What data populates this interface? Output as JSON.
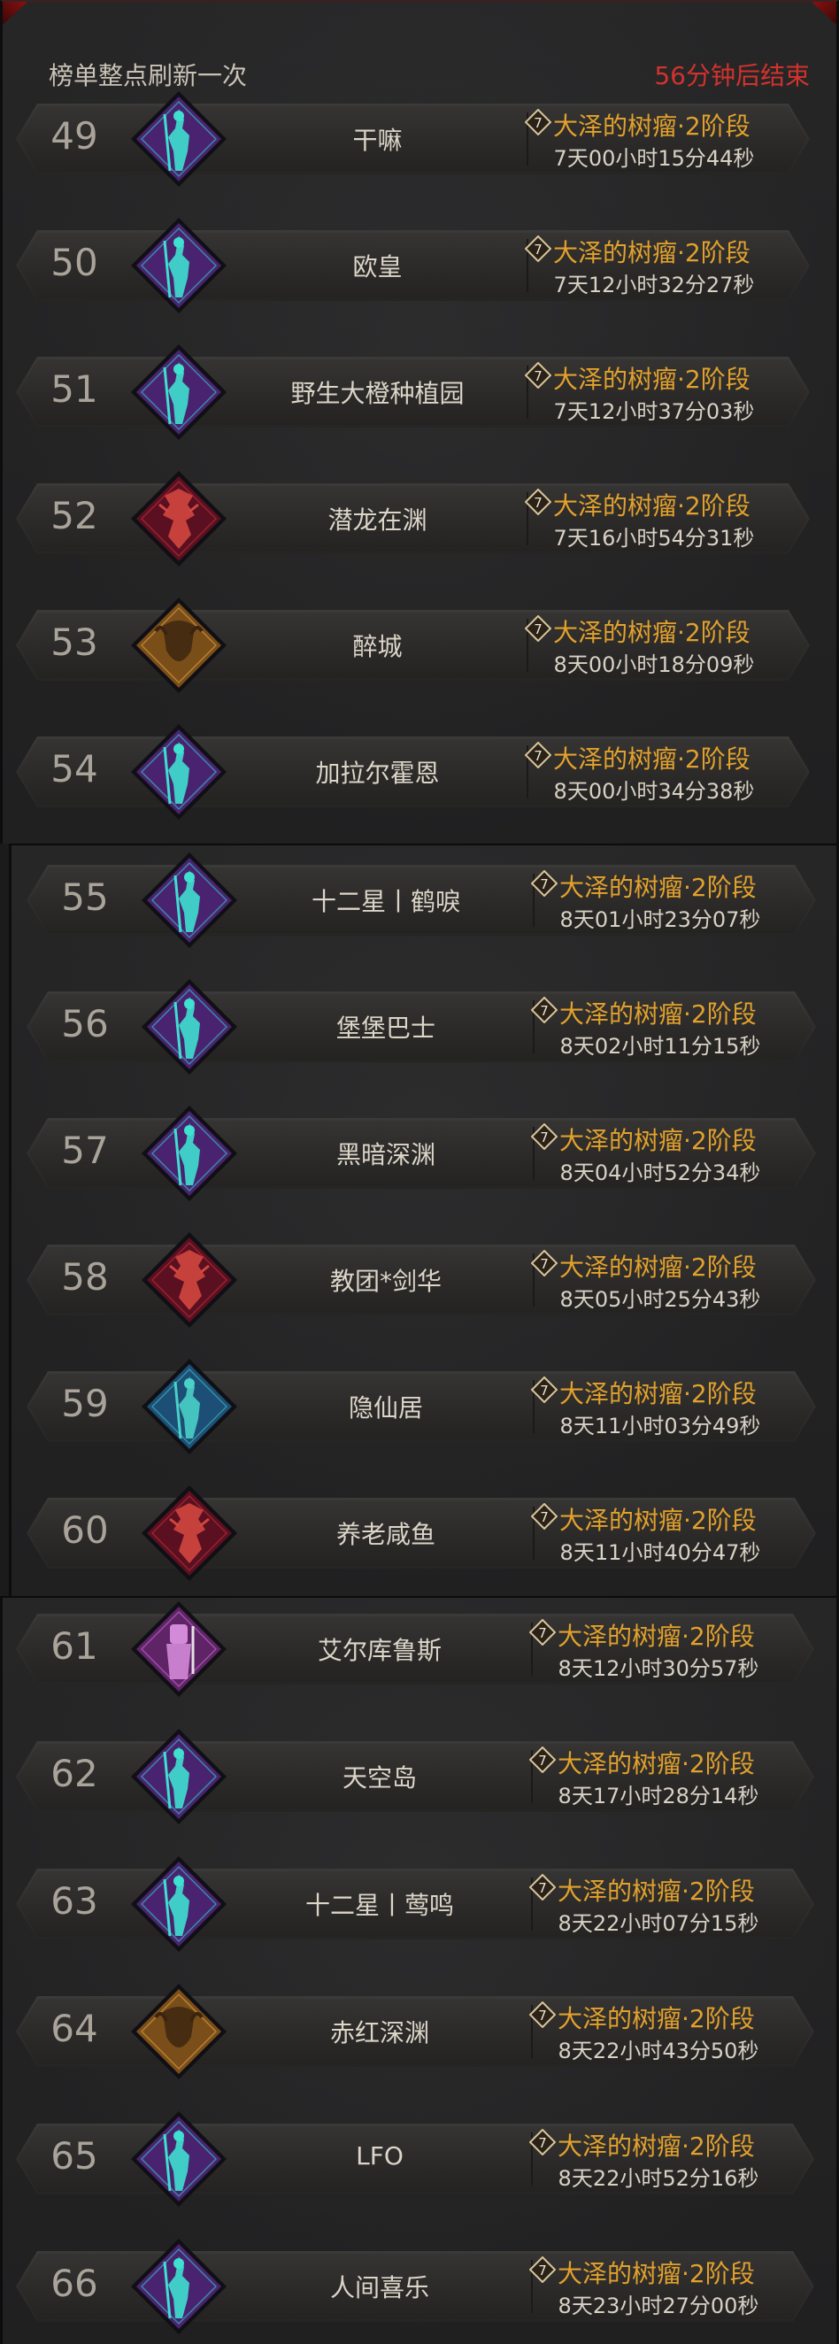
{
  "header": {
    "refresh_note": "榜单整点刷新一次",
    "countdown": "56分钟后结束"
  },
  "colors": {
    "countdown": "#d3322d",
    "boss_name": "#e2a12c",
    "emblem_purple": "#5a2a86",
    "emblem_red": "#6a1420",
    "emblem_gold": "#b5782b",
    "emblem_blue": "#1f5f86",
    "emblem_pink": "#7a2f7c"
  },
  "rows": [
    {
      "rank": "49",
      "name": "干嘛",
      "emblem": "purple-necro-emblem-icon",
      "boss": "大泽的树瘤·2阶段",
      "level": "7",
      "time": "7天00小时15分44秒"
    },
    {
      "rank": "50",
      "name": "欧皇",
      "emblem": "purple-necro-emblem-icon",
      "boss": "大泽的树瘤·2阶段",
      "level": "7",
      "time": "7天12小时32分27秒"
    },
    {
      "rank": "51",
      "name": "野生大橙种植园",
      "emblem": "purple-necro-emblem-icon",
      "boss": "大泽的树瘤·2阶段",
      "level": "7",
      "time": "7天12小时37分03秒"
    },
    {
      "rank": "52",
      "name": "潜龙在渊",
      "emblem": "red-demon-emblem-icon",
      "boss": "大泽的树瘤·2阶段",
      "level": "7",
      "time": "7天16小时54分31秒"
    },
    {
      "rank": "53",
      "name": "醉城",
      "emblem": "gold-barbarian-emblem-icon",
      "boss": "大泽的树瘤·2阶段",
      "level": "7",
      "time": "8天00小时18分09秒"
    },
    {
      "rank": "54",
      "name": "加拉尔霍恩",
      "emblem": "purple-necro-emblem-icon",
      "boss": "大泽的树瘤·2阶段",
      "level": "7",
      "time": "8天00小时34分38秒"
    },
    {
      "rank": "55",
      "name": "十二星丨鹤唳",
      "emblem": "purple-necro-emblem-icon",
      "boss": "大泽的树瘤·2阶段",
      "level": "7",
      "time": "8天01小时23分07秒"
    },
    {
      "rank": "56",
      "name": "堡堡巴士",
      "emblem": "purple-necro-emblem-icon",
      "boss": "大泽的树瘤·2阶段",
      "level": "7",
      "time": "8天02小时11分15秒"
    },
    {
      "rank": "57",
      "name": "黑暗深渊",
      "emblem": "purple-necro-emblem-icon",
      "boss": "大泽的树瘤·2阶段",
      "level": "7",
      "time": "8天04小时52分34秒"
    },
    {
      "rank": "58",
      "name": "教团*剑华",
      "emblem": "red-demon-emblem-icon",
      "boss": "大泽的树瘤·2阶段",
      "level": "7",
      "time": "8天05小时25分43秒"
    },
    {
      "rank": "59",
      "name": "隐仙居",
      "emblem": "blue-monk-emblem-icon",
      "boss": "大泽的树瘤·2阶段",
      "level": "7",
      "time": "8天11小时03分49秒"
    },
    {
      "rank": "60",
      "name": "养老咸鱼",
      "emblem": "red-demon-emblem-icon",
      "boss": "大泽的树瘤·2阶段",
      "level": "7",
      "time": "8天11小时40分47秒"
    },
    {
      "rank": "61",
      "name": "艾尔库鲁斯",
      "emblem": "pink-crusader-emblem-icon",
      "boss": "大泽的树瘤·2阶段",
      "level": "7",
      "time": "8天12小时30分57秒"
    },
    {
      "rank": "62",
      "name": "天空岛",
      "emblem": "purple-necro-emblem-icon",
      "boss": "大泽的树瘤·2阶段",
      "level": "7",
      "time": "8天17小时28分14秒"
    },
    {
      "rank": "63",
      "name": "十二星丨莺鸣",
      "emblem": "purple-necro-emblem-icon",
      "boss": "大泽的树瘤·2阶段",
      "level": "7",
      "time": "8天22小时07分15秒"
    },
    {
      "rank": "64",
      "name": "赤红深渊",
      "emblem": "gold-barbarian-emblem-icon",
      "boss": "大泽的树瘤·2阶段",
      "level": "7",
      "time": "8天22小时43分50秒"
    },
    {
      "rank": "65",
      "name": "LFO",
      "emblem": "purple-necro-emblem-icon",
      "boss": "大泽的树瘤·2阶段",
      "level": "7",
      "time": "8天22小时52分16秒"
    },
    {
      "rank": "66",
      "name": "人间喜乐",
      "emblem": "purple-necro-emblem-icon",
      "boss": "大泽的树瘤·2阶段",
      "level": "7",
      "time": "8天23小时27分00秒"
    }
  ]
}
